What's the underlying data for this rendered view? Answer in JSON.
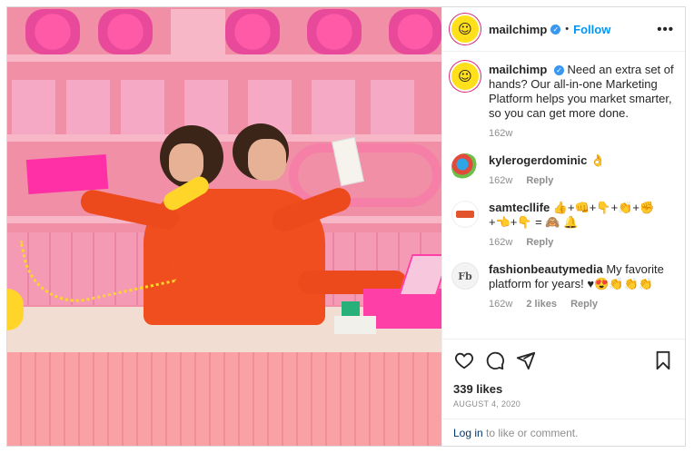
{
  "header": {
    "username": "mailchimp",
    "separator": "•",
    "follow_label": "Follow",
    "more_label": "•••"
  },
  "caption": {
    "username": "mailchimp",
    "text": "Need an extra set of hands? Our all-in-one Marketing Platform helps you market smarter, so you can get more done.",
    "time": "162w"
  },
  "comments": [
    {
      "username": "kylerogerdominic",
      "text": "👌",
      "time": "162w",
      "likes": "",
      "reply": "Reply"
    },
    {
      "username": "samtecllife",
      "text": "👍+👊+👇+👏+✊+👈+👇 = 🙈 🔔",
      "time": "162w",
      "likes": "",
      "reply": "Reply"
    },
    {
      "username": "fashionbeautymedia",
      "text": "My favorite platform for years! ♥😍👏👏👏",
      "time": "162w",
      "likes": "2 likes",
      "reply": "Reply"
    }
  ],
  "actions": {
    "likes": "339 likes",
    "date": "AUGUST 4, 2020"
  },
  "login": {
    "link": "Log in",
    "rest": " to like or comment."
  },
  "avatars": {
    "fashion_initials": "Fb"
  },
  "colors": {
    "link_blue": "#0095f6",
    "verified_blue": "#3897f0",
    "mailchimp_yellow": "#ffe01b"
  }
}
